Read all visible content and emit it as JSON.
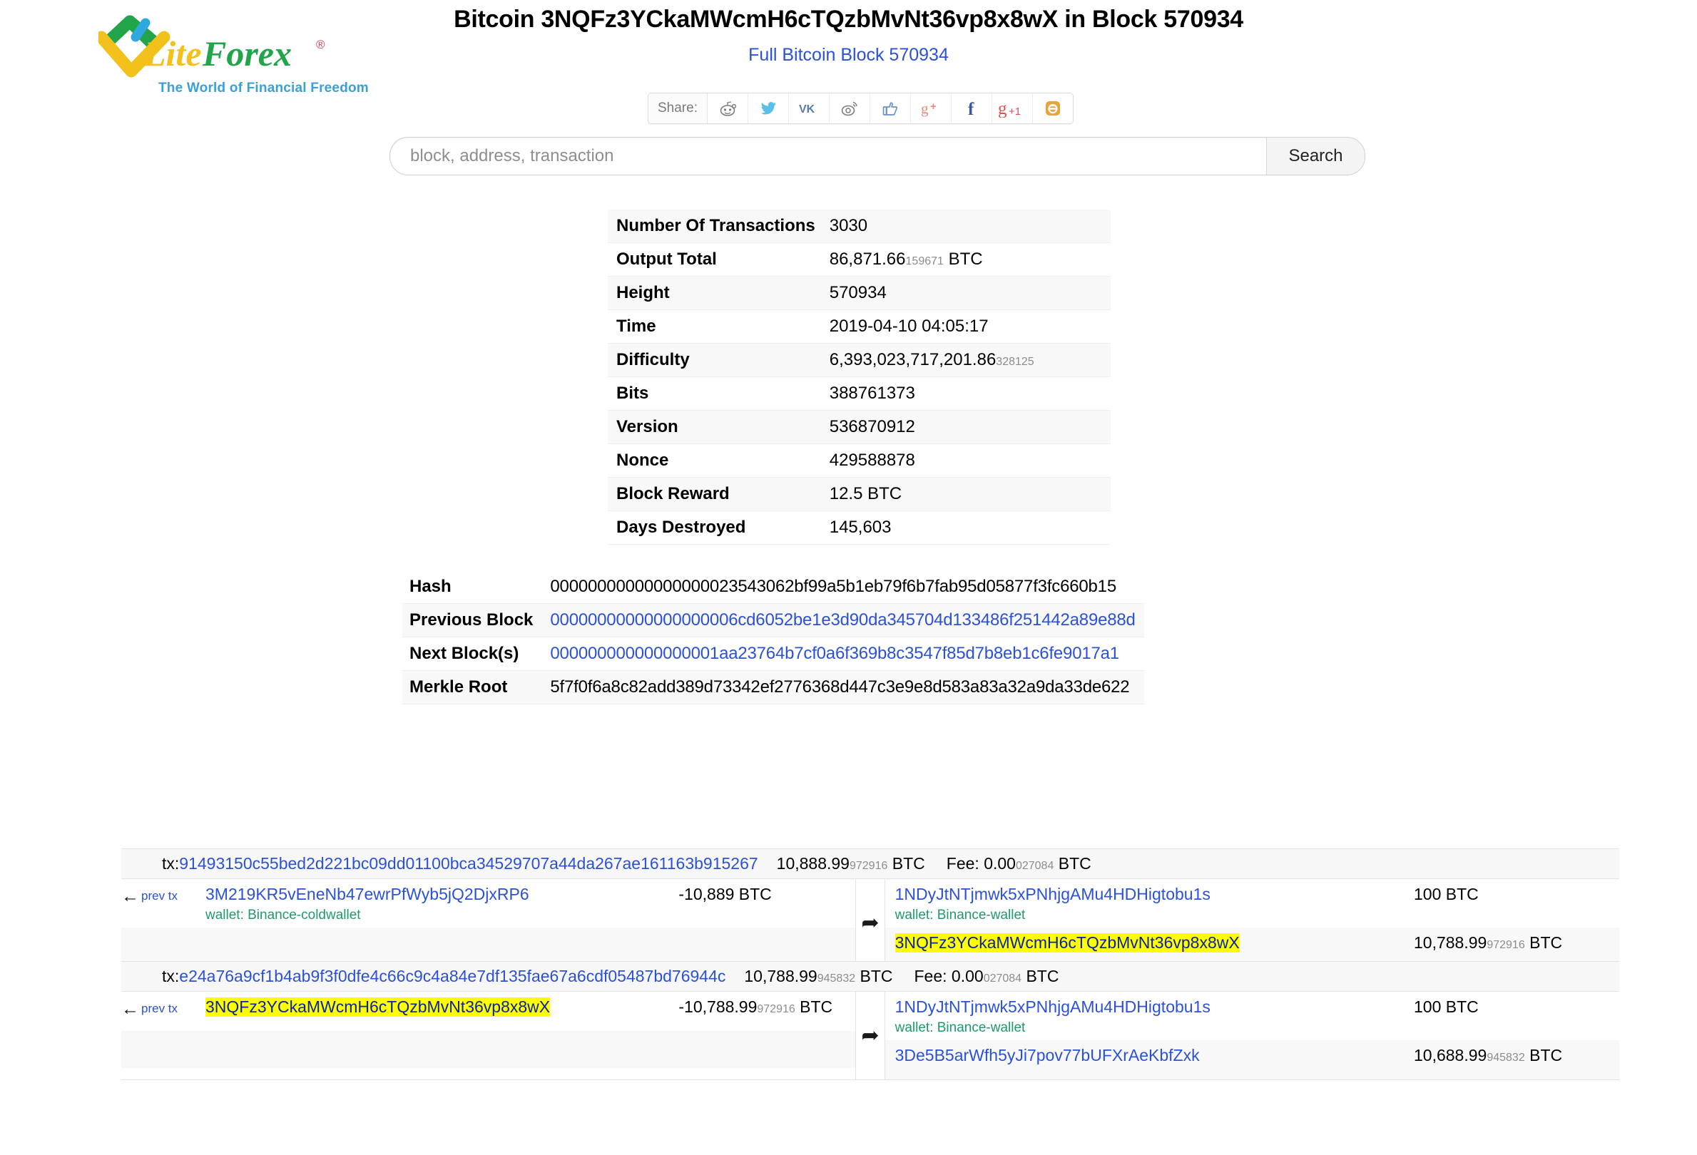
{
  "brand": {
    "name": "LiteForex",
    "tagline": "The World of Financial Freedom",
    "registered_mark": "®"
  },
  "header": {
    "title": "Bitcoin 3NQFz3YCkaMWcmH6cTQzbMvNt36vp8x8wX in Block 570934",
    "subtitle_link": "Full Bitcoin Block 570934"
  },
  "share": {
    "label": "Share:",
    "buttons": [
      {
        "name": "reddit-icon",
        "title": "Reddit"
      },
      {
        "name": "twitter-icon",
        "title": "Twitter"
      },
      {
        "name": "vk-icon",
        "title": "VK"
      },
      {
        "name": "weibo-icon",
        "title": "Sina Weibo"
      },
      {
        "name": "facebook-like-icon",
        "title": "Facebook Like"
      },
      {
        "name": "google-plus-share-icon",
        "title": "Google+ Share"
      },
      {
        "name": "facebook-icon",
        "title": "Facebook"
      },
      {
        "name": "google-plus-one-icon",
        "title": "Google +1"
      },
      {
        "name": "blogger-icon",
        "title": "Blogger"
      }
    ]
  },
  "search": {
    "placeholder": "block, address, transaction",
    "value": "",
    "button_label": "Search"
  },
  "block_info": [
    {
      "label": "Number Of Transactions",
      "value": "3030",
      "small": "",
      "suffix": ""
    },
    {
      "label": "Output Total",
      "value": "86,871.66",
      "small": "159671",
      "suffix": " BTC"
    },
    {
      "label": "Height",
      "value": "570934",
      "small": "",
      "suffix": ""
    },
    {
      "label": "Time",
      "value": "2019-04-10 04:05:17",
      "small": "",
      "suffix": ""
    },
    {
      "label": "Difficulty",
      "value": "6,393,023,717,201.86",
      "small": "328125",
      "suffix": ""
    },
    {
      "label": "Bits",
      "value": "388761373",
      "small": "",
      "suffix": ""
    },
    {
      "label": "Version",
      "value": "536870912",
      "small": "",
      "suffix": ""
    },
    {
      "label": "Nonce",
      "value": "429588878",
      "small": "",
      "suffix": ""
    },
    {
      "label": "Block Reward",
      "value": "12.5 BTC",
      "small": "",
      "suffix": ""
    },
    {
      "label": "Days Destroyed",
      "value": "145,603",
      "small": "",
      "suffix": ""
    }
  ],
  "hashes": {
    "hash_label": "Hash",
    "hash_value": "0000000000000000002 3543062bf99a5b1eb79f6b7fab95d05877f3fc660b15",
    "hash_value_text": "00000000000000000023543062bf99a5b1eb79f6b7fab95d05877f3fc660b15",
    "prev_label": "Previous Block",
    "prev_value": "00000000000000000006cd6052be1e3d90da345704d133486f251442a89e88d",
    "next_label": "Next Block(s)",
    "next_value": "000000000000000001aa23764b7cf0a6f369b8c3547f85d7b8eb1c6fe9017a1",
    "merkle_label": "Merkle Root",
    "merkle_value": "5f7f0f6a8c82add389d73342ef2776368d447c3e9e8d583a83a32a9da33de622"
  },
  "transactions": [
    {
      "tx_prefix": "tx:",
      "txid": "91493150c55bed2d221bc09dd01100bca34529707a44da267ae161163b915267",
      "amount_main": "10,888.99",
      "amount_sub": "972916",
      "amount_unit": " BTC",
      "fee_label": "Fee: ",
      "fee_main": "0.00",
      "fee_sub": "027084",
      "fee_unit": " BTC",
      "inputs": [
        {
          "prev_tx_label": "prev tx",
          "address": "3M219KR5vEneNb47ewrPfWyb5jQ2DjxRP6",
          "highlight": false,
          "wallet": "wallet: Binance-coldwallet",
          "amount_main": "-10,889",
          "amount_sub": "",
          "amount_unit": " BTC"
        }
      ],
      "outputs": [
        {
          "address": "1NDyJtNTjmwk5xPNhjgAMu4HDHigtobu1s",
          "highlight": false,
          "wallet": "wallet: Binance-wallet",
          "amount_main": "100",
          "amount_sub": "",
          "amount_unit": " BTC"
        },
        {
          "address": "3NQFz3YCkaMWcmH6cTQzbMvNt36vp8x8wX",
          "highlight": true,
          "wallet": "",
          "amount_main": "10,788.99",
          "amount_sub": "972916",
          "amount_unit": " BTC"
        }
      ]
    },
    {
      "tx_prefix": "tx:",
      "txid": "e24a76a9cf1b4ab9f3f0dfe4c66c9c4a84e7df135fae67a6cdf05487bd76944c",
      "amount_main": "10,788.99",
      "amount_sub": "945832",
      "amount_unit": " BTC",
      "fee_label": "Fee: ",
      "fee_main": "0.00",
      "fee_sub": "027084",
      "fee_unit": " BTC",
      "inputs": [
        {
          "prev_tx_label": "prev tx",
          "address": "3NQFz3YCkaMWcmH6cTQzbMvNt36vp8x8wX",
          "highlight": true,
          "wallet": "",
          "amount_main": "-10,788.99",
          "amount_sub": "972916",
          "amount_unit": " BTC"
        }
      ],
      "outputs": [
        {
          "address": "1NDyJtNTjmwk5xPNhjgAMu4HDHigtobu1s",
          "highlight": false,
          "wallet": "wallet: Binance-wallet",
          "amount_main": "100",
          "amount_sub": "",
          "amount_unit": " BTC"
        },
        {
          "address": "3De5B5arWfh5yJi7pov77bUFXrAeKbfZxk",
          "highlight": false,
          "wallet": "",
          "amount_main": "10,688.99",
          "amount_sub": "945832",
          "amount_unit": " BTC"
        }
      ]
    }
  ],
  "colors": {
    "link": "#2b51d6",
    "wallet": "#1d9a6c",
    "highlight": "#ffff00",
    "brand_green": "#22a44a",
    "brand_yellow": "#f3c11b",
    "brand_blue": "#3aa0d8"
  }
}
